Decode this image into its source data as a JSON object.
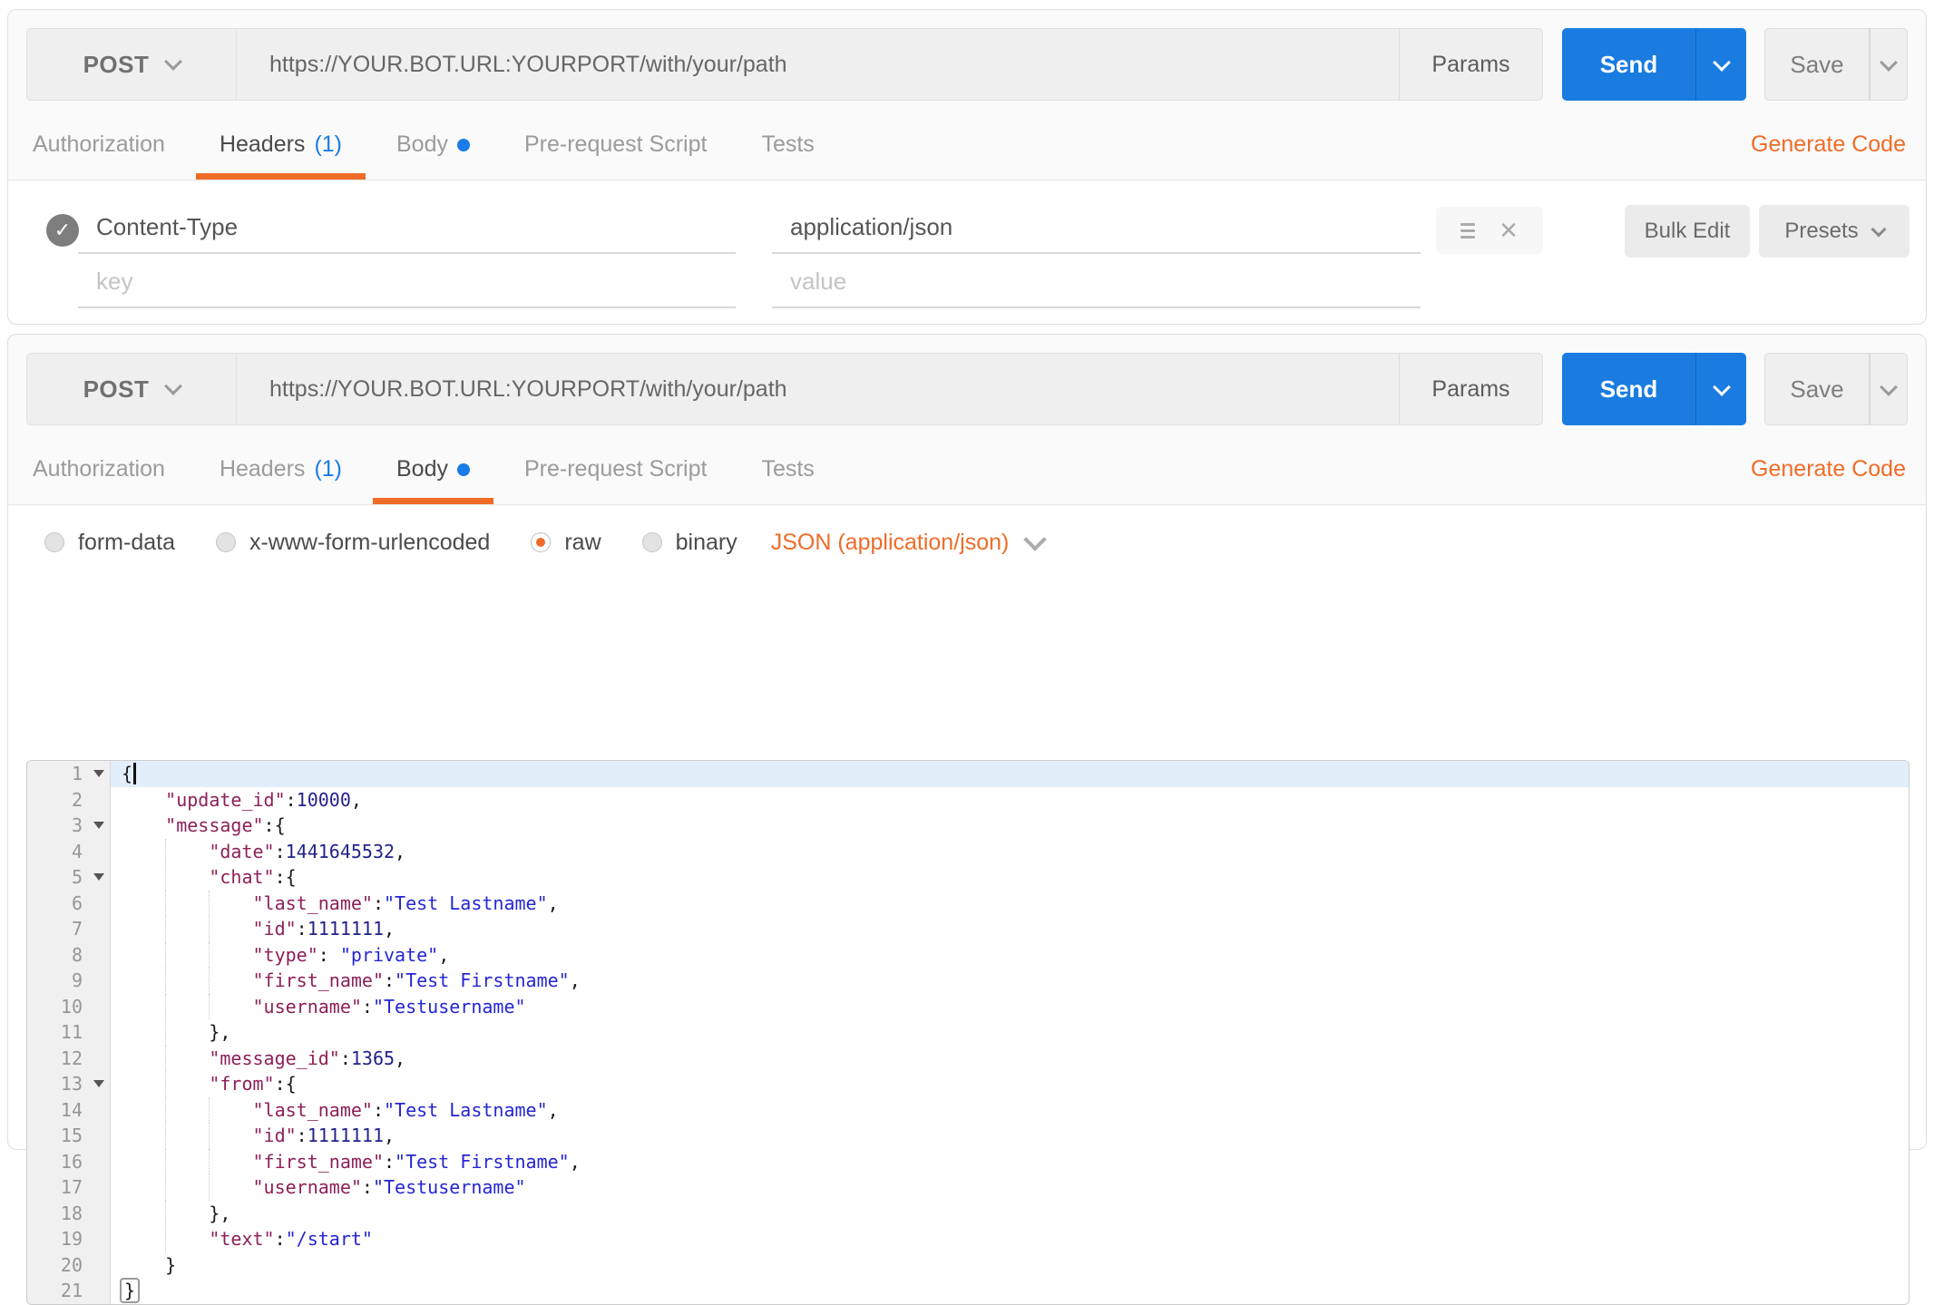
{
  "request1": {
    "method": "POST",
    "url": "https://YOUR.BOT.URL:YOURPORT/with/your/path",
    "params_label": "Params",
    "send_label": "Send",
    "save_label": "Save",
    "generate_code_label": "Generate Code",
    "tabs": {
      "authorization": "Authorization",
      "headers": "Headers",
      "headers_count": "(1)",
      "body": "Body",
      "prerequest": "Pre-request Script",
      "tests": "Tests",
      "active_tab": "Headers"
    },
    "headers_editor": {
      "row": {
        "key": "Content-Type",
        "value": "application/json",
        "enabled": true
      },
      "key_placeholder": "key",
      "value_placeholder": "value",
      "bulk_edit_label": "Bulk Edit",
      "presets_label": "Presets",
      "check_icon": "✓",
      "close_icon": "✕"
    }
  },
  "request2": {
    "method": "POST",
    "url": "https://YOUR.BOT.URL:YOURPORT/with/your/path",
    "params_label": "Params",
    "send_label": "Send",
    "save_label": "Save",
    "generate_code_label": "Generate Code",
    "tabs": {
      "authorization": "Authorization",
      "headers": "Headers",
      "headers_count": "(1)",
      "body": "Body",
      "prerequest": "Pre-request Script",
      "tests": "Tests",
      "active_tab": "Body"
    },
    "body_editor": {
      "modes": {
        "form_data": "form-data",
        "urlencoded": "x-www-form-urlencoded",
        "raw": "raw",
        "binary": "binary"
      },
      "selected_mode": "raw",
      "content_type_label": "JSON (application/json)"
    }
  },
  "colors": {
    "accent_orange": "#ef6c28",
    "primary_blue": "#1a7ce8",
    "json_key": "#8d2057",
    "json_string": "#2525d4",
    "json_number": "#22228c"
  },
  "code_editor": {
    "lines": [
      {
        "n": 1,
        "indent": 0,
        "fold": true,
        "active": true,
        "cursor": true,
        "tokens": [
          {
            "t": "p",
            "v": "{"
          }
        ]
      },
      {
        "n": 2,
        "indent": 1,
        "tokens": [
          {
            "t": "k",
            "v": "\"update_id\""
          },
          {
            "t": "p",
            "v": ":"
          },
          {
            "t": "n",
            "v": "10000"
          },
          {
            "t": "p",
            "v": ","
          }
        ]
      },
      {
        "n": 3,
        "indent": 1,
        "fold": true,
        "tokens": [
          {
            "t": "k",
            "v": "\"message\""
          },
          {
            "t": "p",
            "v": ":{"
          }
        ]
      },
      {
        "n": 4,
        "indent": 2,
        "tokens": [
          {
            "t": "k",
            "v": "\"date\""
          },
          {
            "t": "p",
            "v": ":"
          },
          {
            "t": "n",
            "v": "1441645532"
          },
          {
            "t": "p",
            "v": ","
          }
        ]
      },
      {
        "n": 5,
        "indent": 2,
        "fold": true,
        "tokens": [
          {
            "t": "k",
            "v": "\"chat\""
          },
          {
            "t": "p",
            "v": ":{"
          }
        ]
      },
      {
        "n": 6,
        "indent": 3,
        "tokens": [
          {
            "t": "k",
            "v": "\"last_name\""
          },
          {
            "t": "p",
            "v": ":"
          },
          {
            "t": "s",
            "v": "\"Test Lastname\""
          },
          {
            "t": "p",
            "v": ","
          }
        ]
      },
      {
        "n": 7,
        "indent": 3,
        "tokens": [
          {
            "t": "k",
            "v": "\"id\""
          },
          {
            "t": "p",
            "v": ":"
          },
          {
            "t": "n",
            "v": "1111111"
          },
          {
            "t": "p",
            "v": ","
          }
        ]
      },
      {
        "n": 8,
        "indent": 3,
        "tokens": [
          {
            "t": "k",
            "v": "\"type\""
          },
          {
            "t": "p",
            "v": ": "
          },
          {
            "t": "s",
            "v": "\"private\""
          },
          {
            "t": "p",
            "v": ","
          }
        ]
      },
      {
        "n": 9,
        "indent": 3,
        "tokens": [
          {
            "t": "k",
            "v": "\"first_name\""
          },
          {
            "t": "p",
            "v": ":"
          },
          {
            "t": "s",
            "v": "\"Test Firstname\""
          },
          {
            "t": "p",
            "v": ","
          }
        ]
      },
      {
        "n": 10,
        "indent": 3,
        "tokens": [
          {
            "t": "k",
            "v": "\"username\""
          },
          {
            "t": "p",
            "v": ":"
          },
          {
            "t": "s",
            "v": "\"Testusername\""
          }
        ]
      },
      {
        "n": 11,
        "indent": 2,
        "tokens": [
          {
            "t": "p",
            "v": "},"
          }
        ]
      },
      {
        "n": 12,
        "indent": 2,
        "tokens": [
          {
            "t": "k",
            "v": "\"message_id\""
          },
          {
            "t": "p",
            "v": ":"
          },
          {
            "t": "n",
            "v": "1365"
          },
          {
            "t": "p",
            "v": ","
          }
        ]
      },
      {
        "n": 13,
        "indent": 2,
        "fold": true,
        "tokens": [
          {
            "t": "k",
            "v": "\"from\""
          },
          {
            "t": "p",
            "v": ":{"
          }
        ]
      },
      {
        "n": 14,
        "indent": 3,
        "tokens": [
          {
            "t": "k",
            "v": "\"last_name\""
          },
          {
            "t": "p",
            "v": ":"
          },
          {
            "t": "s",
            "v": "\"Test Lastname\""
          },
          {
            "t": "p",
            "v": ","
          }
        ]
      },
      {
        "n": 15,
        "indent": 3,
        "tokens": [
          {
            "t": "k",
            "v": "\"id\""
          },
          {
            "t": "p",
            "v": ":"
          },
          {
            "t": "n",
            "v": "1111111"
          },
          {
            "t": "p",
            "v": ","
          }
        ]
      },
      {
        "n": 16,
        "indent": 3,
        "tokens": [
          {
            "t": "k",
            "v": "\"first_name\""
          },
          {
            "t": "p",
            "v": ":"
          },
          {
            "t": "s",
            "v": "\"Test Firstname\""
          },
          {
            "t": "p",
            "v": ","
          }
        ]
      },
      {
        "n": 17,
        "indent": 3,
        "tokens": [
          {
            "t": "k",
            "v": "\"username\""
          },
          {
            "t": "p",
            "v": ":"
          },
          {
            "t": "s",
            "v": "\"Testusername\""
          }
        ]
      },
      {
        "n": 18,
        "indent": 2,
        "tokens": [
          {
            "t": "p",
            "v": "},"
          }
        ]
      },
      {
        "n": 19,
        "indent": 2,
        "tokens": [
          {
            "t": "k",
            "v": "\"text\""
          },
          {
            "t": "p",
            "v": ":"
          },
          {
            "t": "s",
            "v": "\"/start\""
          }
        ]
      },
      {
        "n": 20,
        "indent": 1,
        "tokens": [
          {
            "t": "p",
            "v": "}"
          }
        ]
      },
      {
        "n": 21,
        "indent": 0,
        "tokens": [
          {
            "t": "p",
            "v": "}",
            "boxed": true
          }
        ]
      }
    ]
  }
}
